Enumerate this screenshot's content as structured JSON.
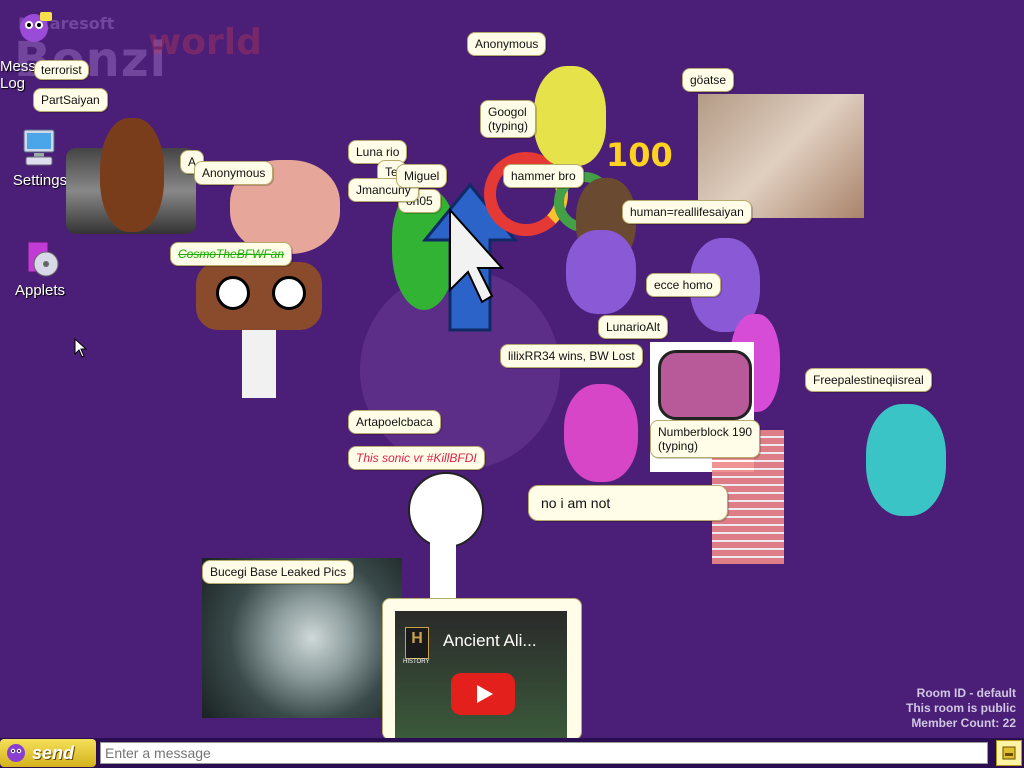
{
  "brand": {
    "small": "Mixaresoft",
    "name": "Bonzi",
    "world": "world"
  },
  "desktop": {
    "message_log": "Message Log",
    "settings": "Settings",
    "applets": "Applets"
  },
  "bubbles": {
    "terrorist": "terrorist",
    "partsaiyan": "PartSaiyan",
    "anonymous_top": "Anonymous",
    "anonymous_left": "Anonymous",
    "anonymous_left_hidden": "A",
    "cosmo": "CosmoTheBFWFan",
    "luna": "Luna rio",
    "te": "Te",
    "miguel": "Miguel",
    "jmancuny": "Jmancuny",
    "on05": "on05",
    "googol": "Googol\n(typing)",
    "hammer": "hammer bro",
    "goatse": "göatse",
    "human": "human=reallifesaiyan",
    "ecce": "ecce homo",
    "lunario": "LunarioAlt",
    "lilix": "lilixRR34 wins, BW Lost",
    "freepal": "Freepalestineqiisreal",
    "artapoel": "Artapoelcbaca",
    "sonic": "This sonic vr #KillBFDI",
    "numberblock": "Numberblock 190\n(typing)",
    "noiamnot": "no i am not",
    "bucegi": "Bucegi Base Leaked Pics"
  },
  "video": {
    "title": "Ancient Ali...",
    "channel": "HISTORY"
  },
  "number100": "100",
  "room": {
    "id_line": "Room ID - default",
    "public_line": "This room is public",
    "count_line": "Member Count: 22"
  },
  "chat": {
    "send_label": "send",
    "placeholder": "Enter a message"
  }
}
